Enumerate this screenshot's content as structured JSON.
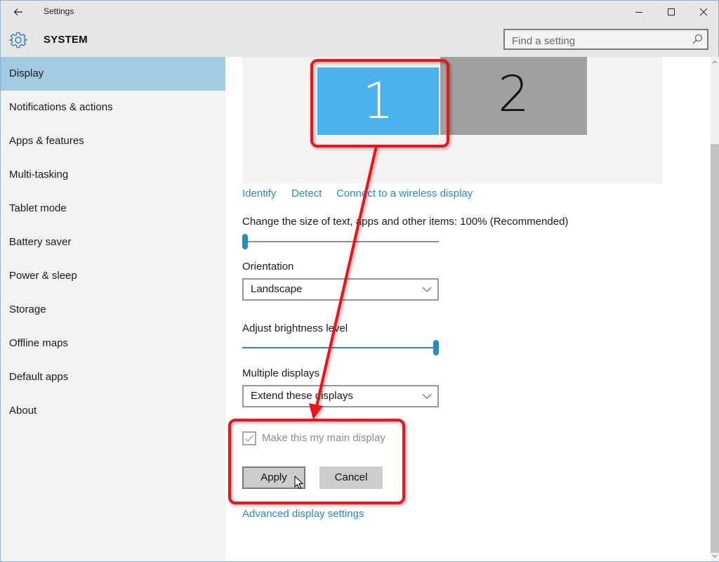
{
  "window": {
    "title": "Settings",
    "controls": {
      "minimize": "—",
      "maximize": "☐",
      "close": "✕"
    }
  },
  "header": {
    "section_title": "SYSTEM",
    "search_placeholder": "Find a setting"
  },
  "sidebar": {
    "active_index": 0,
    "items": [
      {
        "label": "Display"
      },
      {
        "label": "Notifications & actions"
      },
      {
        "label": "Apps & features"
      },
      {
        "label": "Multi-tasking"
      },
      {
        "label": "Tablet mode"
      },
      {
        "label": "Battery saver"
      },
      {
        "label": "Power & sleep"
      },
      {
        "label": "Storage"
      },
      {
        "label": "Offline maps"
      },
      {
        "label": "Default apps"
      },
      {
        "label": "About"
      }
    ]
  },
  "display": {
    "monitors": [
      {
        "number": "1",
        "selected": true,
        "color": "#4ab3ef"
      },
      {
        "number": "2",
        "selected": false,
        "color": "#a0a0a0"
      }
    ],
    "links": {
      "identify": "Identify",
      "detect": "Detect",
      "wireless": "Connect to a wireless display",
      "advanced": "Advanced display settings"
    },
    "scale": {
      "label": "Change the size of text, apps and other items: 100% (Recommended)",
      "value_fraction": 0.0
    },
    "orientation": {
      "label": "Orientation",
      "value": "Landscape"
    },
    "brightness": {
      "label": "Adjust brightness level",
      "value_fraction": 1.0
    },
    "multiple_displays": {
      "label": "Multiple displays",
      "value": "Extend these displays"
    },
    "main_display": {
      "label": "Make this my main display",
      "checked": true,
      "disabled": true
    },
    "buttons": {
      "apply": "Apply",
      "cancel": "Cancel"
    }
  },
  "colors": {
    "accent": "#2b8ac3",
    "sidebar_active": "#a2cae2",
    "annotation": "#e8141b"
  }
}
